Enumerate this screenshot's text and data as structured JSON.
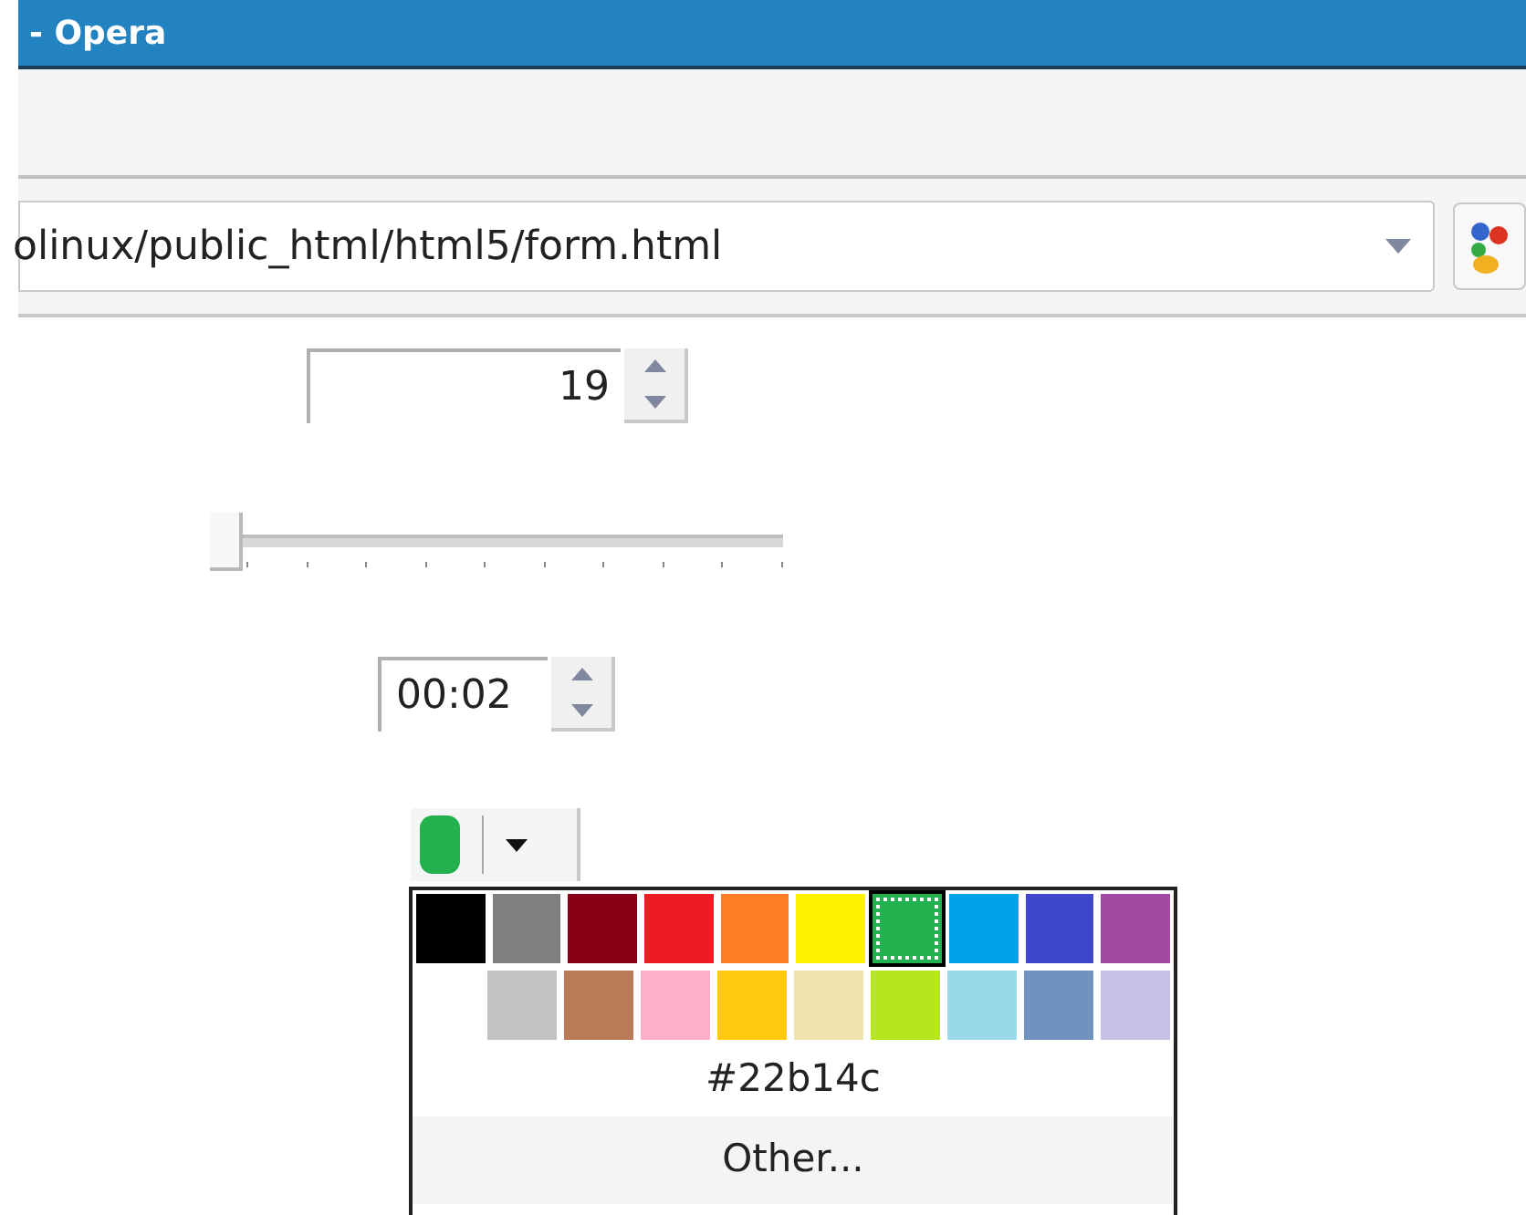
{
  "window": {
    "title": "- Opera"
  },
  "address_bar": {
    "value": "olinux/public_html/html5/form.html"
  },
  "number_field": {
    "value": "19"
  },
  "range_slider": {
    "level": 0
  },
  "time_field": {
    "value": "00:02"
  },
  "color_picker": {
    "color": "#22b14c",
    "expanded": true
  },
  "palette": {
    "rows": [
      [
        {
          "color": "#000000",
          "selected": false
        },
        {
          "color": "#7f7f7f",
          "selected": false
        },
        {
          "color": "#880015",
          "selected": false
        },
        {
          "color": "#ed1c24",
          "selected": false
        },
        {
          "color": "#ff7f27",
          "selected": false
        },
        {
          "color": "#fff200",
          "selected": false
        },
        {
          "color": "#22b14c",
          "selected": true
        },
        {
          "color": "#00a2e8",
          "selected": false
        },
        {
          "color": "#3f48cc",
          "selected": false
        },
        {
          "color": "#a349a4",
          "selected": false
        }
      ],
      [
        {
          "color": "#c3c3c3",
          "selected": false
        },
        {
          "color": "#b97a57",
          "selected": false
        },
        {
          "color": "#ffaec9",
          "selected": false
        },
        {
          "color": "#ffc90e",
          "selected": false
        },
        {
          "color": "#efe4b0",
          "selected": false
        },
        {
          "color": "#b5e61d",
          "selected": false
        },
        {
          "color": "#99d9ea",
          "selected": false
        },
        {
          "color": "#7092be",
          "selected": false
        },
        {
          "color": "#c8bfe7",
          "selected": false
        }
      ]
    ],
    "hex_label": "#22b14c",
    "other_button": "Other..."
  }
}
